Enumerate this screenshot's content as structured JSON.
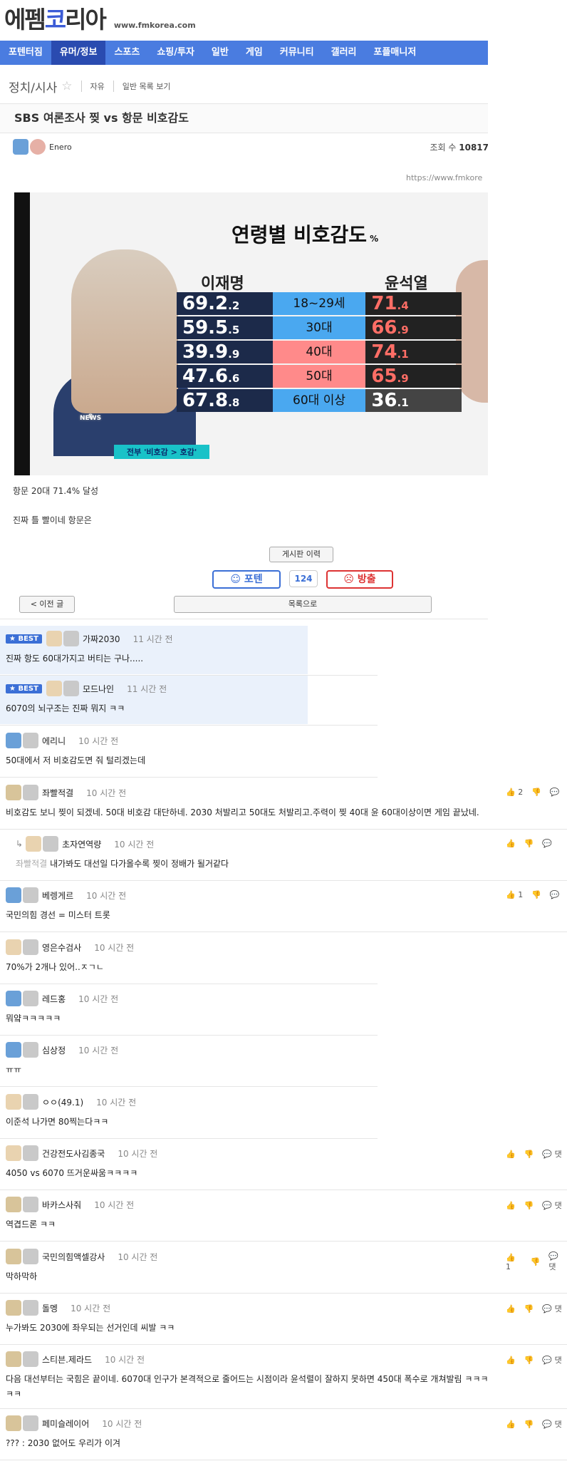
{
  "site": {
    "logo_a": "에펨",
    "logo_b": "코",
    "logo_c": "리아",
    "url": "www.fmkorea.com"
  },
  "nav": [
    "포텐터짐",
    "유머/정보",
    "스포츠",
    "쇼핑/투자",
    "일반",
    "게임",
    "커뮤니티",
    "갤러리",
    "포플매니저"
  ],
  "board": {
    "title": "정치/시사",
    "link1": "자유",
    "link2": "일반 목록 보기"
  },
  "post": {
    "title": "SBS 여론조사 찢 vs 항문 비호감도",
    "author": "Enero",
    "views_label": "조회 수",
    "views": "10817",
    "source_url": "https://www.fmkore",
    "body1": "항문 20대 71.4% 달성",
    "body2": "진짜 틀 빨이네 항문은"
  },
  "chart_data": {
    "type": "table",
    "title": "연령별 비호감도",
    "unit": "%",
    "columns": [
      "이재명",
      "연령",
      "윤석열"
    ],
    "rows": [
      {
        "age": "18~29세",
        "lee": "69.2",
        "yoon": "71.4"
      },
      {
        "age": "30대",
        "lee": "59.5",
        "yoon": "66.9"
      },
      {
        "age": "40대",
        "lee": "39.9",
        "yoon": "74.1"
      },
      {
        "age": "50대",
        "lee": "47.6",
        "yoon": "65.9"
      },
      {
        "age": "60대 이상",
        "lee": "67.8",
        "yoon": "36.1"
      }
    ],
    "tag": "전부 '비호감 > 호감'",
    "news_logo": "8",
    "news_label": "NEWS"
  },
  "actions": {
    "history": "게시판 이력",
    "poten": "포텐",
    "count": "124",
    "bangchul": "방출",
    "prev": "< 이전 글",
    "list": "목록으로"
  },
  "best_label": "BEST",
  "comments": [
    {
      "nick": "가짜2030",
      "time": "11 시간 전",
      "text": "진짜 항도 60대가지고 버티는 구나.....",
      "best": true
    },
    {
      "nick": "모드나인",
      "time": "11 시간 전",
      "text": "6070의 뇌구조는 진짜 뭐지 ㅋㅋ",
      "best": true
    },
    {
      "nick": "에리니",
      "time": "10 시간 전",
      "text": "50대에서 저 비호감도면 줘 털리겠는데"
    },
    {
      "nick": "좌빨적결",
      "time": "10 시간 전",
      "text": "비호감도 보니 찢이 되겠네. 50대 비호감 대단하네. 2030 처발리고 50대도 처발리고.주력이 찢 40대 윤 60대이상이면 게임 끝났네.",
      "likes": "2"
    },
    {
      "nick": "초자연역량",
      "time": "10 시간 전",
      "ref": "좌빨적결",
      "text": "내가봐도 대선일 다가올수록 찢이 정배가 될거같다"
    },
    {
      "nick": "베렝게르",
      "time": "10 시간 전",
      "text": "국민의힘 경선 = 미스터 트롯",
      "likes": "1"
    },
    {
      "nick": "영은수검사",
      "time": "10 시간 전",
      "text": "70%가 2개나 있어..ㅈㄱㄴ"
    },
    {
      "nick": "레드홍",
      "time": "10 시간 전",
      "text": "뭐얔ㅋㅋㅋㅋㅋ"
    },
    {
      "nick": "심상정",
      "time": "10 시간 전",
      "text": "ㅠㅠ"
    },
    {
      "nick": "ㅇㅇ(49.1)",
      "time": "10 시간 전",
      "text": "이준석 나가면 80찍는다ㅋㅋ"
    },
    {
      "nick": "건강전도사김종국",
      "time": "10 시간 전",
      "text": "4050 vs 6070 뜨거운싸움ㅋㅋㅋㅋ"
    },
    {
      "nick": "바카스사줘",
      "time": "10 시간 전",
      "text": "역겹드론 ㅋㅋ"
    },
    {
      "nick": "국민의힘액셀강사",
      "time": "10 시간 전",
      "text": "막하막하",
      "likes": "1"
    },
    {
      "nick": "돌멩",
      "time": "10 시간 전",
      "text": "누가봐도 2030에 좌우되는 선거인데 씨발 ㅋㅋ"
    },
    {
      "nick": "스티븐.제라드",
      "time": "10 시간 전",
      "text": "다음 대선부터는 국힘은 끝이네. 6070대 인구가 본격적으로 줄어드는 시점이라 윤석렬이 잘하지 못하면 450대 폭수로 개쳐발림 ㅋㅋㅋ",
      "text2": "ㅋㅋ"
    },
    {
      "nick": "페미슬레이어",
      "time": "10 시간 전",
      "text": "??? : 2030 없어도 우리가 이겨"
    }
  ],
  "reply_label": "댓"
}
